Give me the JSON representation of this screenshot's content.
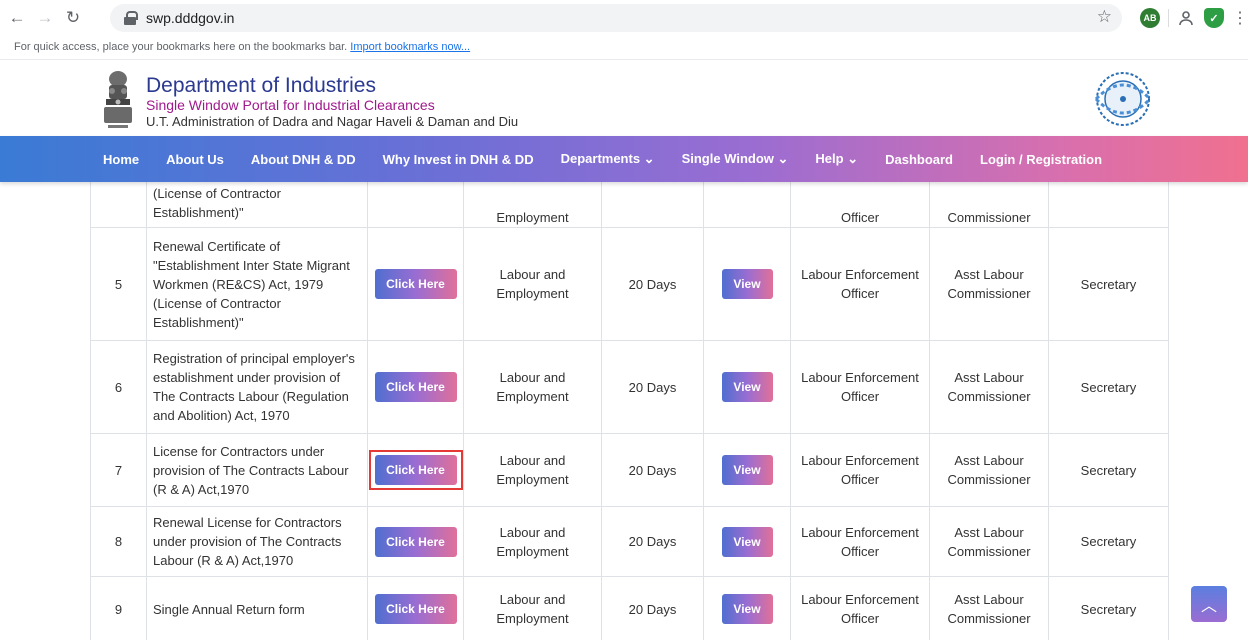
{
  "browser": {
    "url": "swp.dddgov.in",
    "bookmarks_text": "For quick access, place your bookmarks here on the bookmarks bar.",
    "bookmarks_link": "Import bookmarks now...",
    "ext_ab": "AB"
  },
  "header": {
    "title": "Department of Industries",
    "subtitle": "Single Window Portal for Industrial Clearances",
    "admin": "U.T. Administration of Dadra and Nagar Haveli & Daman and Diu"
  },
  "nav": {
    "items": [
      "Home",
      "About Us",
      "About DNH & DD",
      "Why Invest in DNH & DD",
      "Departments ⌄",
      "Single Window ⌄",
      "Help ⌄",
      "Dashboard",
      "Login / Registration"
    ]
  },
  "table": {
    "partial_row": {
      "name": "(License of Contractor Establishment)\"",
      "dept": "Employment",
      "officer": "Officer",
      "commissioner": "Commissioner"
    },
    "rows": [
      {
        "num": "5",
        "name": "Renewal Certificate of \"Establishment Inter State Migrant Workmen (RE&CS) Act, 1979 (License of Contractor Establishment)\"",
        "btn": "Click Here",
        "dept": "Labour and Employment",
        "days": "20 Days",
        "view": "View",
        "officer": "Labour Enforcement Officer",
        "commissioner": "Asst Labour Commissioner",
        "secretary": "Secretary"
      },
      {
        "num": "6",
        "name": "Registration of principal employer's establishment under provision of The Contracts Labour (Regulation and Abolition) Act, 1970",
        "btn": "Click Here",
        "dept": "Labour and Employment",
        "days": "20 Days",
        "view": "View",
        "officer": "Labour Enforcement Officer",
        "commissioner": "Asst Labour Commissioner",
        "secretary": "Secretary"
      },
      {
        "num": "7",
        "name": "License for Contractors under provision of The Contracts Labour (R & A) Act,1970",
        "btn": "Click Here",
        "dept": "Labour and Employment",
        "days": "20 Days",
        "view": "View",
        "officer": "Labour Enforcement Officer",
        "commissioner": "Asst Labour Commissioner",
        "secretary": "Secretary"
      },
      {
        "num": "8",
        "name": "Renewal License for Contractors under provision of The Contracts Labour (R & A) Act,1970",
        "btn": "Click Here",
        "dept": "Labour and Employment",
        "days": "20 Days",
        "view": "View",
        "officer": "Labour Enforcement Officer",
        "commissioner": "Asst Labour Commissioner",
        "secretary": "Secretary"
      },
      {
        "num": "9",
        "name": "Single Annual Return form",
        "btn": "Click Here",
        "dept": "Labour and Employment",
        "days": "20 Days",
        "view": "View",
        "officer": "Labour Enforcement Officer",
        "commissioner": "Asst Labour Commissioner",
        "secretary": "Secretary"
      }
    ]
  }
}
